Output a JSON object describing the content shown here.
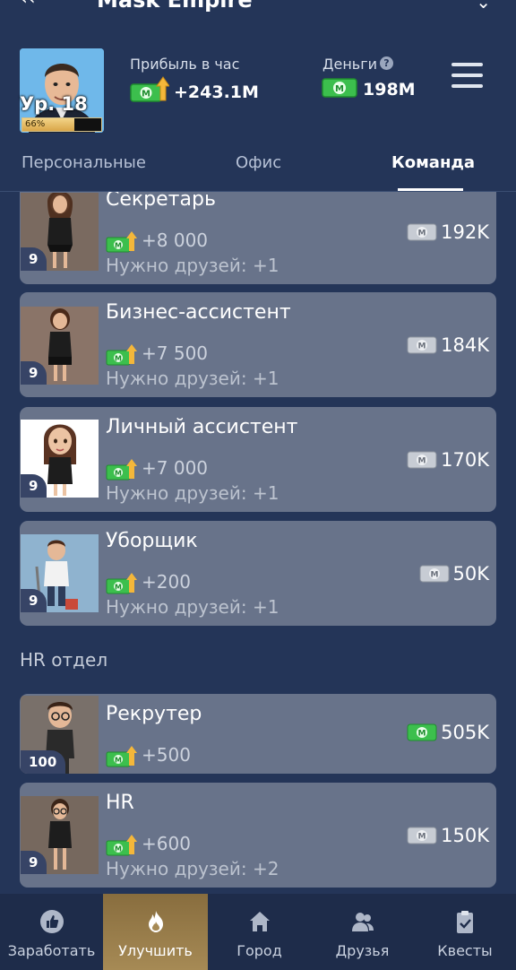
{
  "app": {
    "title": "Mask Empire"
  },
  "player": {
    "level_label": "Ур. 18",
    "level_progress_percent": 66,
    "level_progress_label": "66%"
  },
  "stats": {
    "profit_label": "Прибыль в час",
    "profit_value": "+243.1M",
    "money_label": "Деньги",
    "money_value": "198M"
  },
  "tabs": [
    {
      "label": "Персональные",
      "active": false
    },
    {
      "label": "Офис",
      "active": false
    },
    {
      "label": "Команда",
      "active": true
    }
  ],
  "cards": [
    {
      "name": "Секретарь",
      "profit": "+8 000",
      "friends": "Нужно друзей: +1",
      "price": "192K",
      "level": "9",
      "price_icon": "grey-cash-icon"
    },
    {
      "name": "Бизнес-ассистент",
      "profit": "+7 500",
      "friends": "Нужно друзей: +1",
      "price": "184K",
      "level": "9",
      "price_icon": "grey-cash-icon"
    },
    {
      "name": "Личный ассистент",
      "profit": "+7 000",
      "friends": "Нужно друзей: +1",
      "price": "170K",
      "level": "9",
      "price_icon": "grey-cash-icon"
    },
    {
      "name": "Уборщик",
      "profit": "+200",
      "friends": "Нужно друзей: +1",
      "price": "50K",
      "level": "9",
      "price_icon": "grey-cash-icon"
    }
  ],
  "section_hr": {
    "title": "HR отдел"
  },
  "hr_cards": [
    {
      "name": "Рекрутер",
      "profit": "+500",
      "friends": "",
      "price": "505K",
      "level": "100",
      "price_icon": "green-cash-icon"
    },
    {
      "name": "HR",
      "profit": "+600",
      "friends": "Нужно друзей: +2",
      "price": "150K",
      "level": "9",
      "price_icon": "grey-cash-icon"
    }
  ],
  "nav": [
    {
      "label": "Заработать",
      "icon": "thumbs-up-icon",
      "active": false
    },
    {
      "label": "Улучшить",
      "icon": "flame-icon",
      "active": true
    },
    {
      "label": "Город",
      "icon": "house-icon",
      "active": false
    },
    {
      "label": "Друзья",
      "icon": "users-icon",
      "active": false
    },
    {
      "label": "Квесты",
      "icon": "clipboard-icon",
      "active": false
    }
  ],
  "colors": {
    "background": "#243558",
    "card": "#68738a",
    "nav_active": "#a68a55",
    "cash_green": "#4dc95a"
  }
}
